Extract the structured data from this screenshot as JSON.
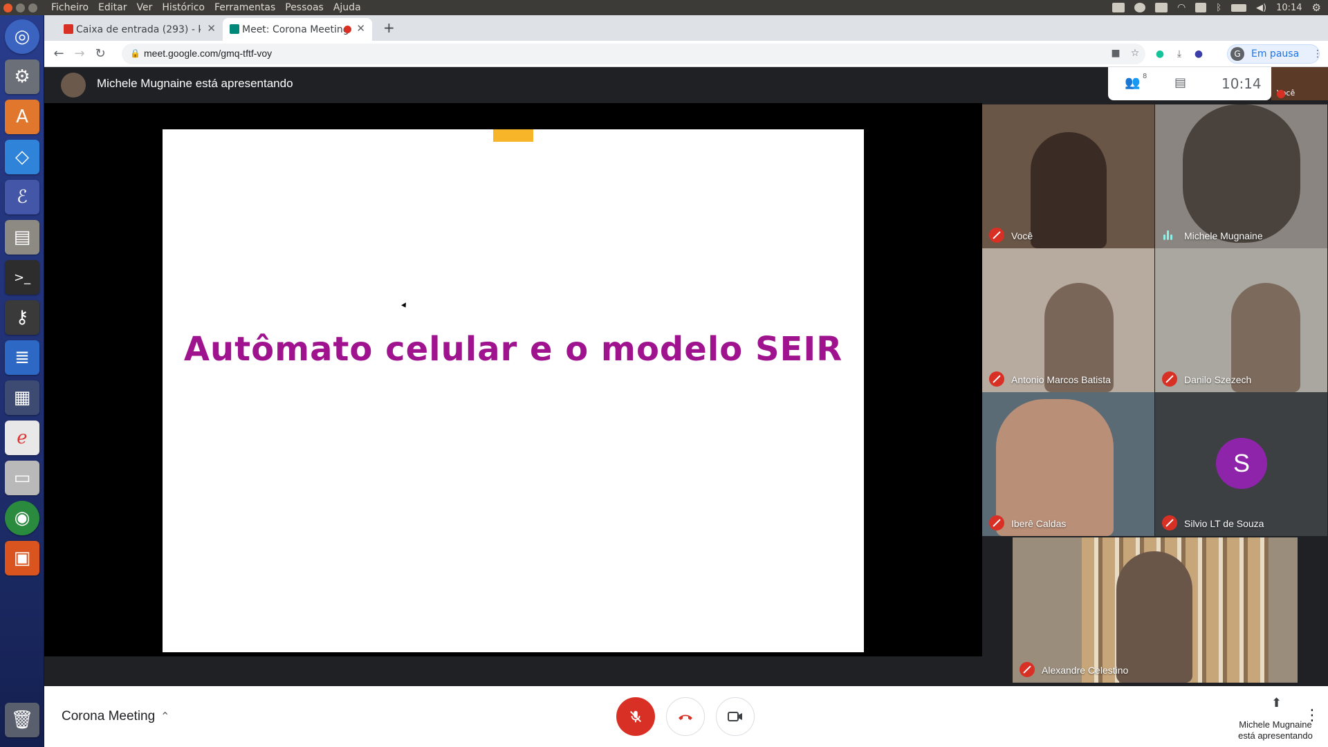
{
  "system": {
    "menu": [
      "Ficheiro",
      "Editar",
      "Ver",
      "Histórico",
      "Ferramentas",
      "Pessoas",
      "Ajuda"
    ],
    "time": "10:14"
  },
  "browser": {
    "tabs": [
      {
        "label": "Caixa de entrada (293) - k",
        "active": false
      },
      {
        "label": "Meet: Corona Meeting",
        "active": true
      }
    ],
    "url": "meet.google.com/gmq-tftf-voy",
    "profile_letter": "G",
    "profile_label": "Em pausa"
  },
  "meet": {
    "presenter_text": "Michele Mugnaine está apresentando",
    "participants_count": "8",
    "clock": "10:14",
    "self_label": "Você",
    "slide_title": "Autômato celular e o modelo SEIR",
    "tiles": [
      {
        "name": "Você",
        "muted": true,
        "bg": "#6a5646"
      },
      {
        "name": "Michele Mugnaine",
        "muted": false,
        "bg": "#8a8580"
      },
      {
        "name": "Antonio Marcos Batista",
        "muted": true,
        "bg": "#b7aba0"
      },
      {
        "name": "Danilo Szezech",
        "muted": true,
        "bg": "#a9a79f"
      },
      {
        "name": "Iberê Caldas",
        "muted": true,
        "bg": "#5b6b76"
      },
      {
        "name": "Silvio LT de Souza",
        "muted": true,
        "bg": "#3c4043",
        "avatar_letter": "S"
      },
      {
        "name": "Alexandre Celestino",
        "muted": true,
        "bg": "#9a8d7c"
      }
    ],
    "meeting_name": "Corona Meeting",
    "presenting_line1": "Michele Mugnaine",
    "presenting_line2": "está apresentando"
  },
  "colors": {
    "slide_title": "#a0138e",
    "mute_red": "#d93025",
    "avatar_purple": "#8e24aa"
  }
}
